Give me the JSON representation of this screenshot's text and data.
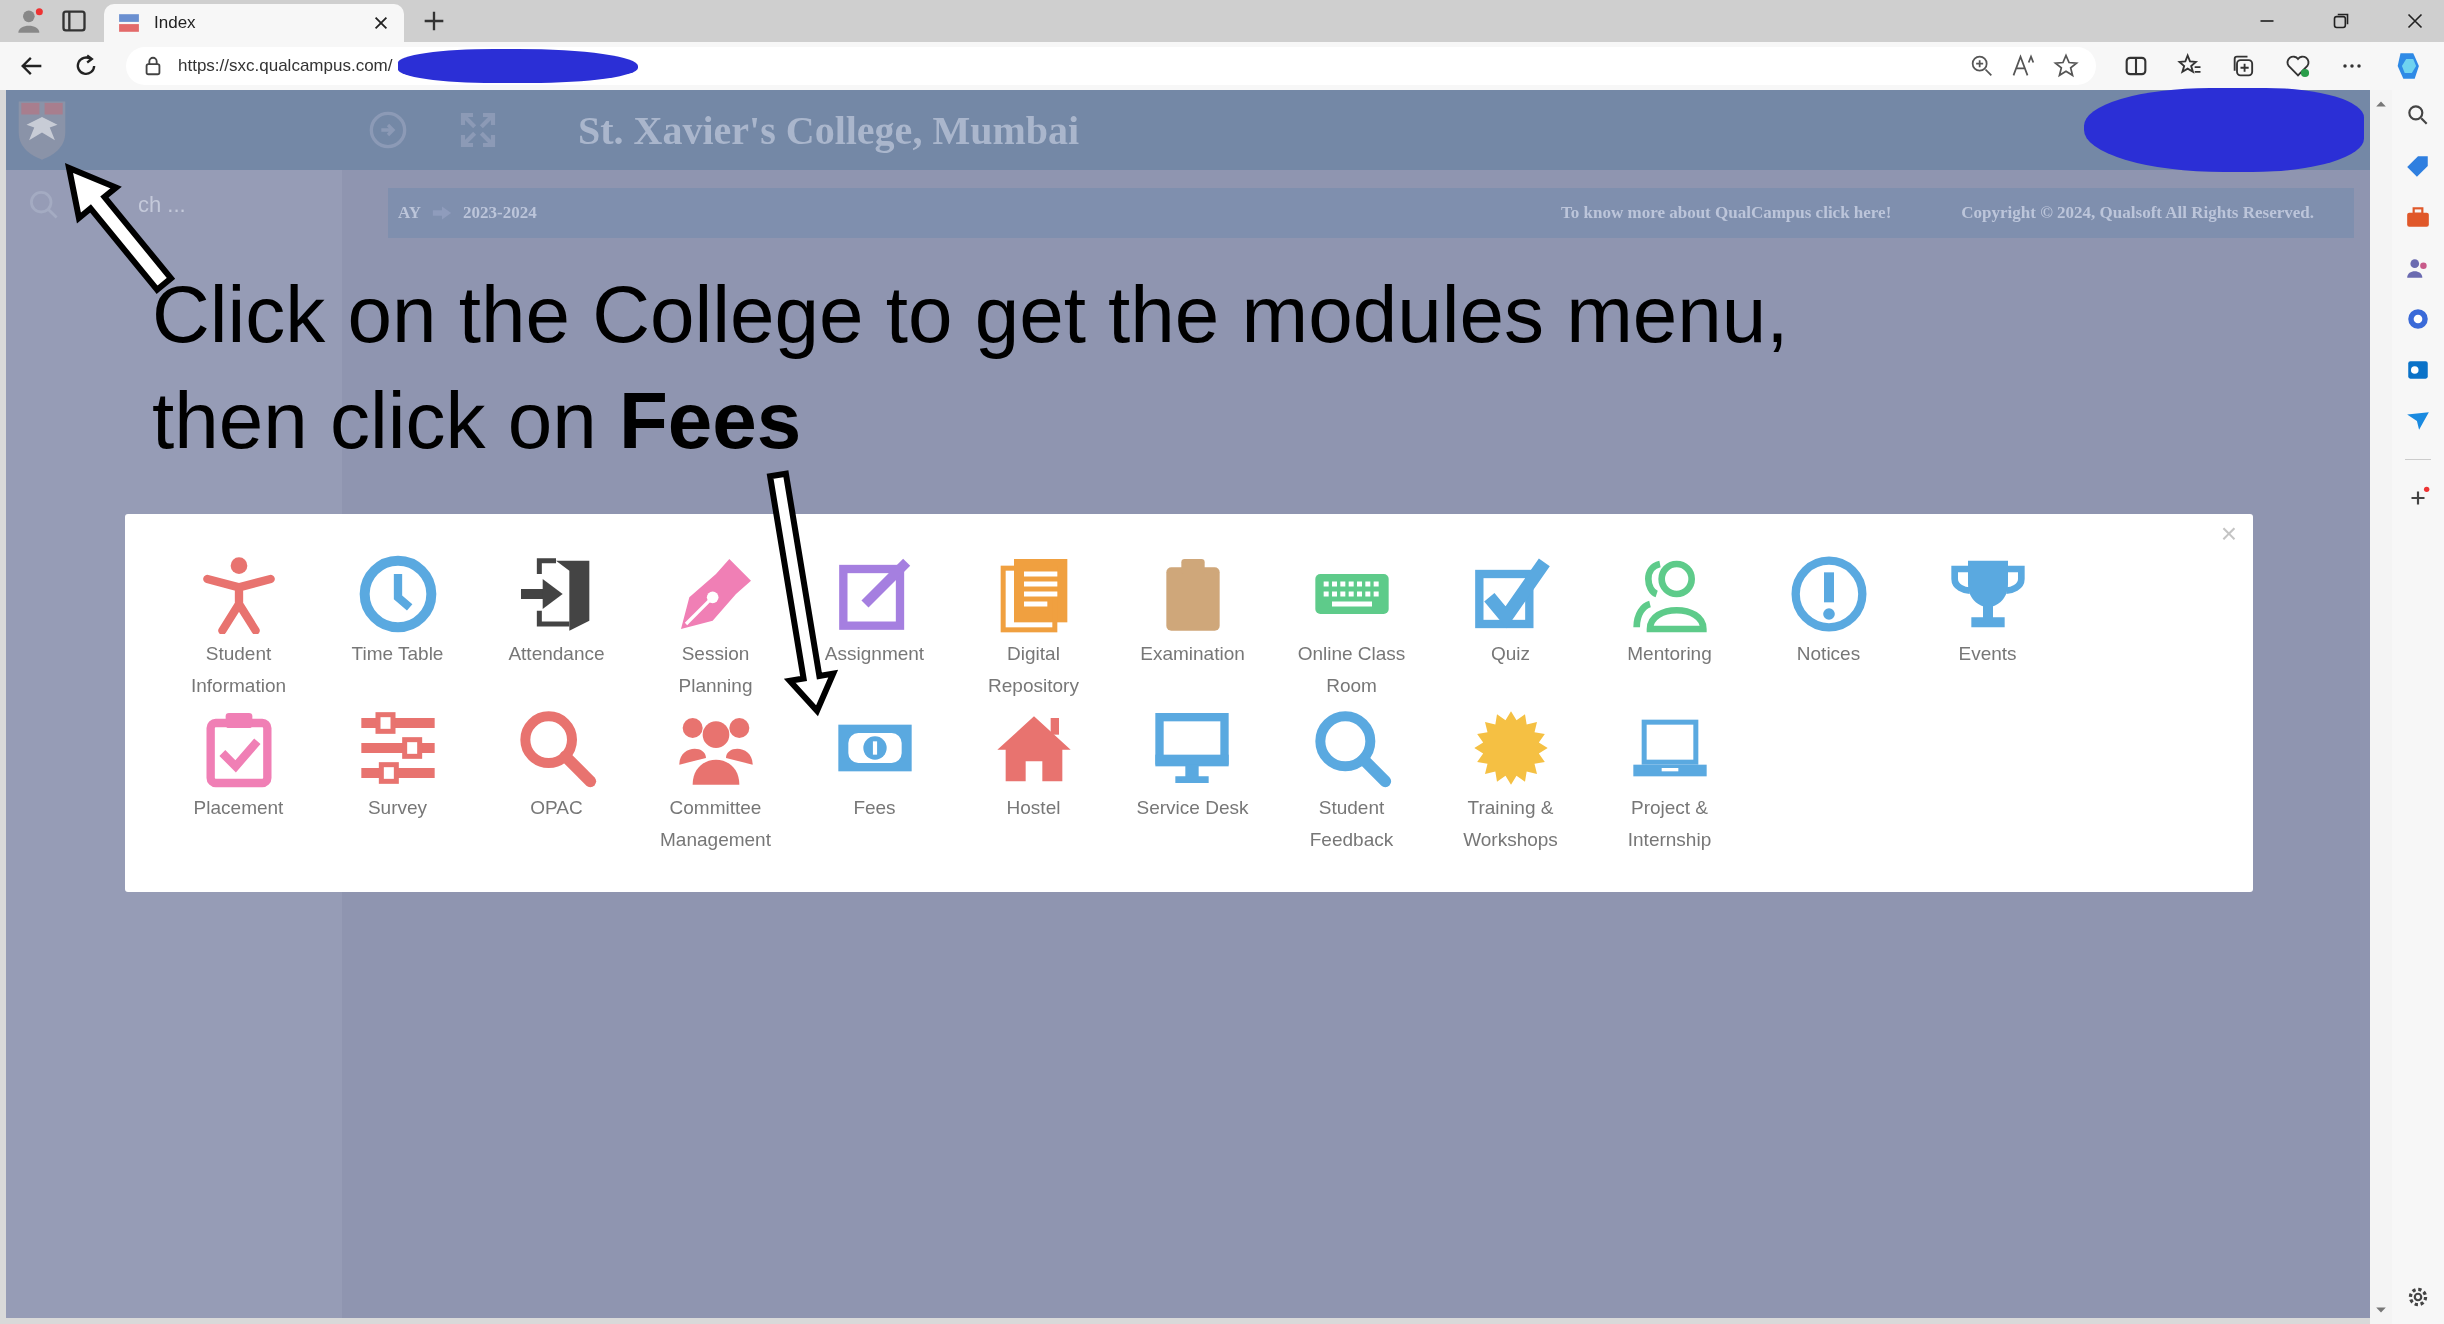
{
  "browser": {
    "tab": {
      "title": "Index"
    },
    "url": "https://sxc.qualcampus.com/"
  },
  "header": {
    "title": "St. Xavier's College, Mumbai"
  },
  "sidebar": {
    "search": {
      "placeholder": "ch ..."
    }
  },
  "info_bar": {
    "year_label": "AY",
    "year": "2023-2024",
    "about_link": "To know more about QualCampus click here!",
    "copyright": "Copyright © 2024, Qualsoft All Rights Reserved."
  },
  "annotation": {
    "lines": [
      "Click on the College to get the modules menu,",
      "then click on **Fees**"
    ]
  },
  "modules_panel": {
    "close": "×",
    "rows": [
      [
        {
          "label": "Student Information"
        },
        {
          "label": "Time Table"
        },
        {
          "label": "Attendance"
        },
        {
          "label": "Session Planning"
        },
        {
          "label": "Assignment"
        },
        {
          "label": "Digital Repository"
        },
        {
          "label": "Examination"
        },
        {
          "label": "Online Class Room"
        },
        {
          "label": "Quiz"
        },
        {
          "label": "Mentoring"
        },
        {
          "label": "Notices"
        },
        {
          "label": "Events"
        }
      ],
      [
        {
          "label": "Placement"
        },
        {
          "label": "Survey"
        },
        {
          "label": "OPAC"
        },
        {
          "label": "Committee Management"
        },
        {
          "label": "Fees"
        },
        {
          "label": "Hostel"
        },
        {
          "label": "Service Desk"
        },
        {
          "label": "Student Feedback"
        },
        {
          "label": "Training & Workshops"
        },
        {
          "label": "Project & Internship"
        }
      ]
    ]
  }
}
